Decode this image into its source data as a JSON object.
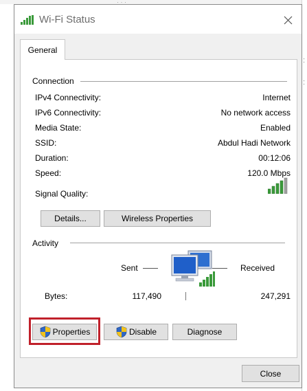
{
  "window": {
    "title": "Wi-Fi Status",
    "tabs": [
      "General"
    ]
  },
  "connection": {
    "heading": "Connection",
    "rows": [
      {
        "label": "IPv4 Connectivity:",
        "value": "Internet"
      },
      {
        "label": "IPv6 Connectivity:",
        "value": "No network access"
      },
      {
        "label": "Media State:",
        "value": "Enabled"
      },
      {
        "label": "SSID:",
        "value": "Abdul Hadi Network"
      },
      {
        "label": "Duration:",
        "value": "00:12:06"
      },
      {
        "label": "Speed:",
        "value": "120.0 Mbps"
      }
    ],
    "signal_label": "Signal Quality:",
    "signal_bars": 5,
    "details_label": "Details...",
    "wireless_label": "Wireless Properties"
  },
  "activity": {
    "heading": "Activity",
    "sent_label": "Sent",
    "received_label": "Received",
    "bytes_label": "Bytes:",
    "sent_value": "117,490",
    "received_value": "247,291"
  },
  "buttons": {
    "properties": "Properties",
    "disable": "Disable",
    "diagnose": "Diagnose",
    "close": "Close"
  },
  "colors": {
    "highlight": "#c0202a",
    "signal": "#3a9a3a",
    "shield_blue": "#2f67c5",
    "shield_yellow": "#f2c21b"
  },
  "icons": {
    "title": "wifi-signal-icon",
    "signal": "signal-bars-icon",
    "network": "network-computers-icon",
    "shield": "uac-shield-icon",
    "close": "close-icon"
  }
}
